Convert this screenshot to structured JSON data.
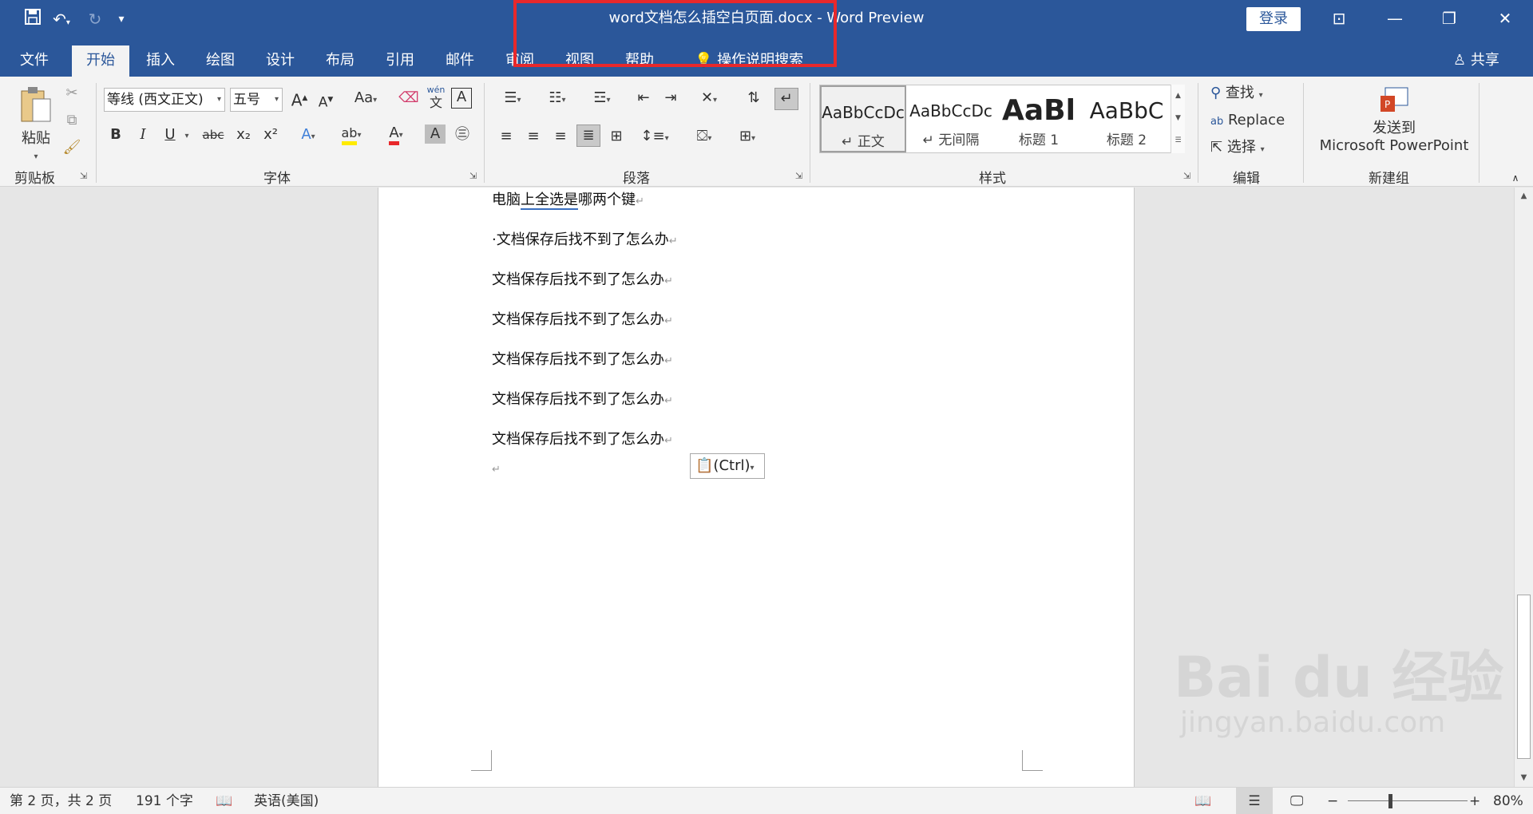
{
  "title_bar": {
    "title": "word文档怎么插空白页面.docx  -  Word Preview",
    "login": "登录",
    "quick_access": {
      "undo": "↶",
      "redo": "↻",
      "customize": "▾"
    },
    "window": {
      "ribbon_display": "⊡",
      "minimize": "—",
      "restore": "❐",
      "close": "✕"
    }
  },
  "tabs": {
    "items": [
      "文件",
      "开始",
      "插入",
      "绘图",
      "设计",
      "布局",
      "引用",
      "邮件",
      "审阅",
      "视图",
      "帮助"
    ],
    "active": "开始",
    "tell_me": "操作说明搜索",
    "share": "共享"
  },
  "ribbon": {
    "clipboard": {
      "paste": "粘贴",
      "label": "剪贴板"
    },
    "font": {
      "font_name": "等线 (西文正文)",
      "font_size": "五号",
      "change_case": "Aa",
      "phonetic_top": "wén",
      "phonetic_bottom": "文",
      "bold": "B",
      "italic": "I",
      "underline": "U",
      "strike": "abc",
      "subscript": "x₂",
      "superscript": "x²",
      "label": "字体"
    },
    "paragraph": {
      "label": "段落"
    },
    "styles": {
      "items": [
        {
          "sample": "AaBbCcDc",
          "name": "↵ 正文"
        },
        {
          "sample": "AaBbCcDc",
          "name": "↵ 无间隔"
        },
        {
          "sample": "AaBl",
          "name": "标题 1"
        },
        {
          "sample": "AaBbC",
          "name": "标题 2"
        }
      ],
      "label": "样式"
    },
    "editing": {
      "find": "查找",
      "replace": "Replace",
      "select": "选择",
      "label": "编辑"
    },
    "new_group": {
      "send_line1": "发送到",
      "send_line2": "Microsoft PowerPoint",
      "label": "新建组"
    }
  },
  "document": {
    "first_para": {
      "before": "电脑",
      "underlined": "上全选是",
      "after": "哪两个键"
    },
    "paragraphs": [
      "·文档保存后找不到了怎么办",
      "文档保存后找不到了怎么办",
      "文档保存后找不到了怎么办",
      "文档保存后找不到了怎么办",
      "文档保存后找不到了怎么办",
      "文档保存后找不到了怎么办"
    ],
    "para_mark": "↵",
    "paste_options": "(Ctrl)"
  },
  "status_bar": {
    "page": "第 2 页，共 2 页",
    "words": "191 个字",
    "language": "英语(美国)",
    "zoom": "80%",
    "zoom_out": "−",
    "zoom_in": "+"
  },
  "watermark": {
    "main": "Bai du 经验",
    "sub": "jingyan.baidu.com"
  }
}
